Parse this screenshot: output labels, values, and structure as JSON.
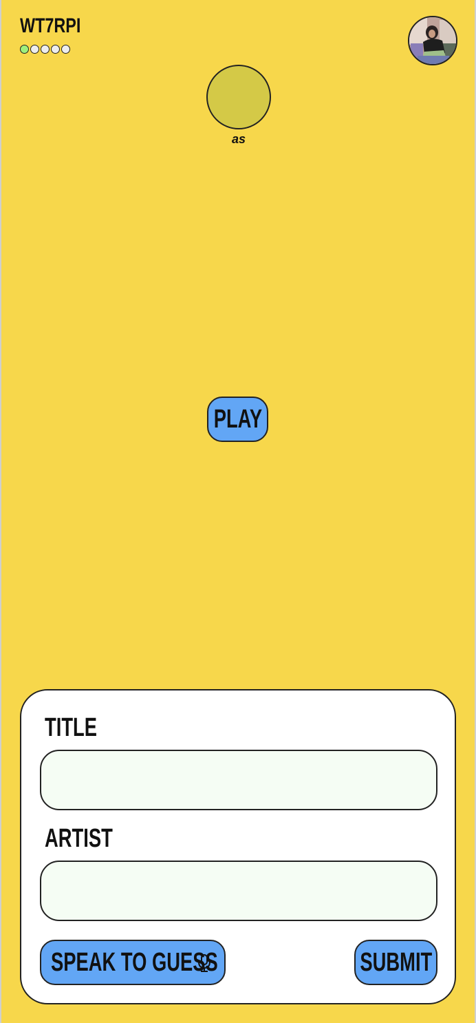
{
  "colors": {
    "background": "#f7d74b",
    "accent": "#62a6f5",
    "player_circle": "#d4c947",
    "dot_active": "#9ef07d"
  },
  "header": {
    "room_code": "WT7RPI",
    "progress_dots": {
      "total": 5,
      "active_index": 0
    },
    "avatar_icon": "user-photo-avatar"
  },
  "player": {
    "name": "as"
  },
  "controls": {
    "play_label": "PLAY"
  },
  "guess_form": {
    "title_label": "TITLE",
    "title_value": "",
    "artist_label": "ARTIST",
    "artist_value": "",
    "speak_label": "SPEAK TO GUESS",
    "speak_icon": "microphone-icon",
    "submit_label": "SUBMIT"
  }
}
